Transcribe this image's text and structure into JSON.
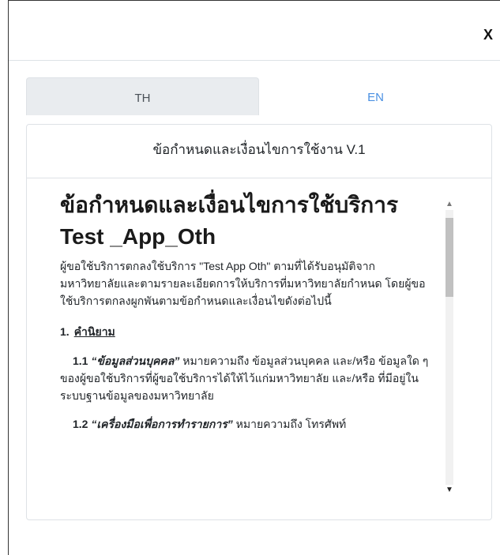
{
  "modal": {
    "close_label": "X"
  },
  "tabs": [
    {
      "label": "TH",
      "active": true
    },
    {
      "label": "EN",
      "active": false
    }
  ],
  "card": {
    "header": "ข้อกำหนดและเงื่อนไขการใช้งาน V.1"
  },
  "document": {
    "title": "ข้อกำหนดและเงื่อนไขการใช้บริการ Test _App_Oth",
    "intro": "ผู้ขอใช้บริการตกลงใช้บริการ \"Test App Oth\" ตามที่ได้รับอนุมัติจากมหาวิทยาลัยและตามรายละเอียดการให้บริการที่มหาวิทยาลัยกำหนด โดยผู้ขอใช้บริการตกลงผูกพันตามข้อกำหนดและเงื่อนไขดังต่อไปนี้",
    "section1": {
      "number": "1.",
      "title": "คำนิยาม"
    },
    "definitions": [
      {
        "number": "1.1",
        "term": "“ข้อมูลส่วนบุคคล”",
        "text": " หมายความถึง ข้อมูลส่วนบุคคล และ/หรือ ข้อมูลใด ๆ ของผู้ขอใช้บริการที่ผู้ขอใช้บริการได้ให้ไว้แก่มหาวิทยาลัย และ/หรือ ที่มีอยู่ในระบบฐานข้อมูลของมหาวิทยาลัย"
      },
      {
        "number": "1.2",
        "term": "“เครื่องมือเพื่อการทำรายการ”",
        "text": " หมายความถึง โทรศัพท์"
      }
    ]
  },
  "scrollbar": {
    "up_icon": "▲",
    "down_icon": "▼"
  }
}
